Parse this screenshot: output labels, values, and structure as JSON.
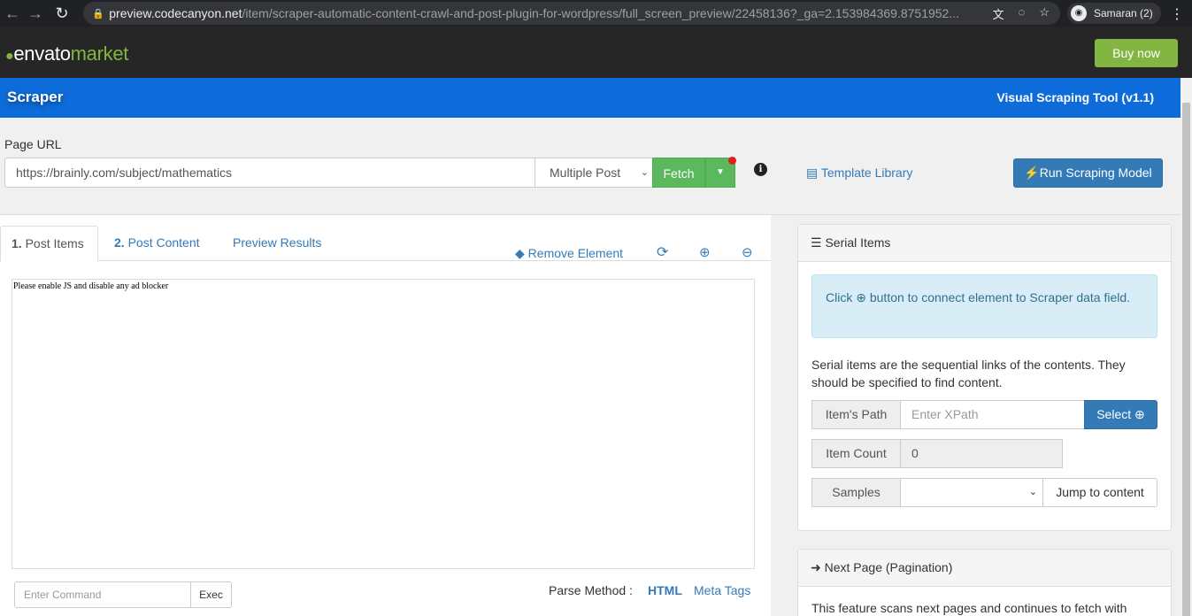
{
  "browser": {
    "url_host": "preview.codecanyon.net",
    "url_path": "/item/scraper-automatic-content-crawl-and-post-plugin-for-wordpress/full_screen_preview/22458136?_ga=2.153984369.8751952...",
    "profile_name": "Samaran (2)"
  },
  "envato": {
    "logo_envato": "envato",
    "logo_market": "market",
    "buy_now": "Buy now"
  },
  "header": {
    "brand": "Scraper",
    "tool_title": "Visual Scraping Tool (v1.1)"
  },
  "url_section": {
    "label": "Page URL",
    "url_value": "https://brainly.com/subject/mathematics",
    "post_mode": "Multiple Post",
    "fetch_label": "Fetch",
    "template_library": "Template Library",
    "run_model": "Run Scraping Model"
  },
  "tabs": [
    {
      "num": "1.",
      "label": "Post Items"
    },
    {
      "num": "2.",
      "label": "Post Content"
    },
    {
      "num": "",
      "label": "Preview Results"
    }
  ],
  "toolbar": {
    "remove_element": "Remove Element"
  },
  "preview": {
    "message": "Please enable JS and disable any ad blocker"
  },
  "command": {
    "placeholder": "Enter Command",
    "exec": "Exec"
  },
  "parse": {
    "label": "Parse Method :",
    "html": "HTML",
    "meta": "Meta Tags"
  },
  "serial": {
    "title": "Serial Items",
    "alert_before": "Click ",
    "alert_after": " button to connect element to Scraper data field.",
    "description": "Serial items are the sequential links of the contents. They should be specified to find content.",
    "items_path_label": "Item's Path",
    "items_path_placeholder": "Enter XPath",
    "select_label": "Select",
    "item_count_label": "Item Count",
    "item_count_value": "0",
    "samples_label": "Samples",
    "jump_label": "Jump to content"
  },
  "pagination": {
    "title": "Next Page (Pagination)",
    "description": "This feature scans next pages and continues to fetch with"
  },
  "colors": {
    "header_blue": "#0d6cd9",
    "envato_green": "#82b541",
    "fetch_green": "#5cb85c",
    "primary_blue": "#337ab7"
  }
}
